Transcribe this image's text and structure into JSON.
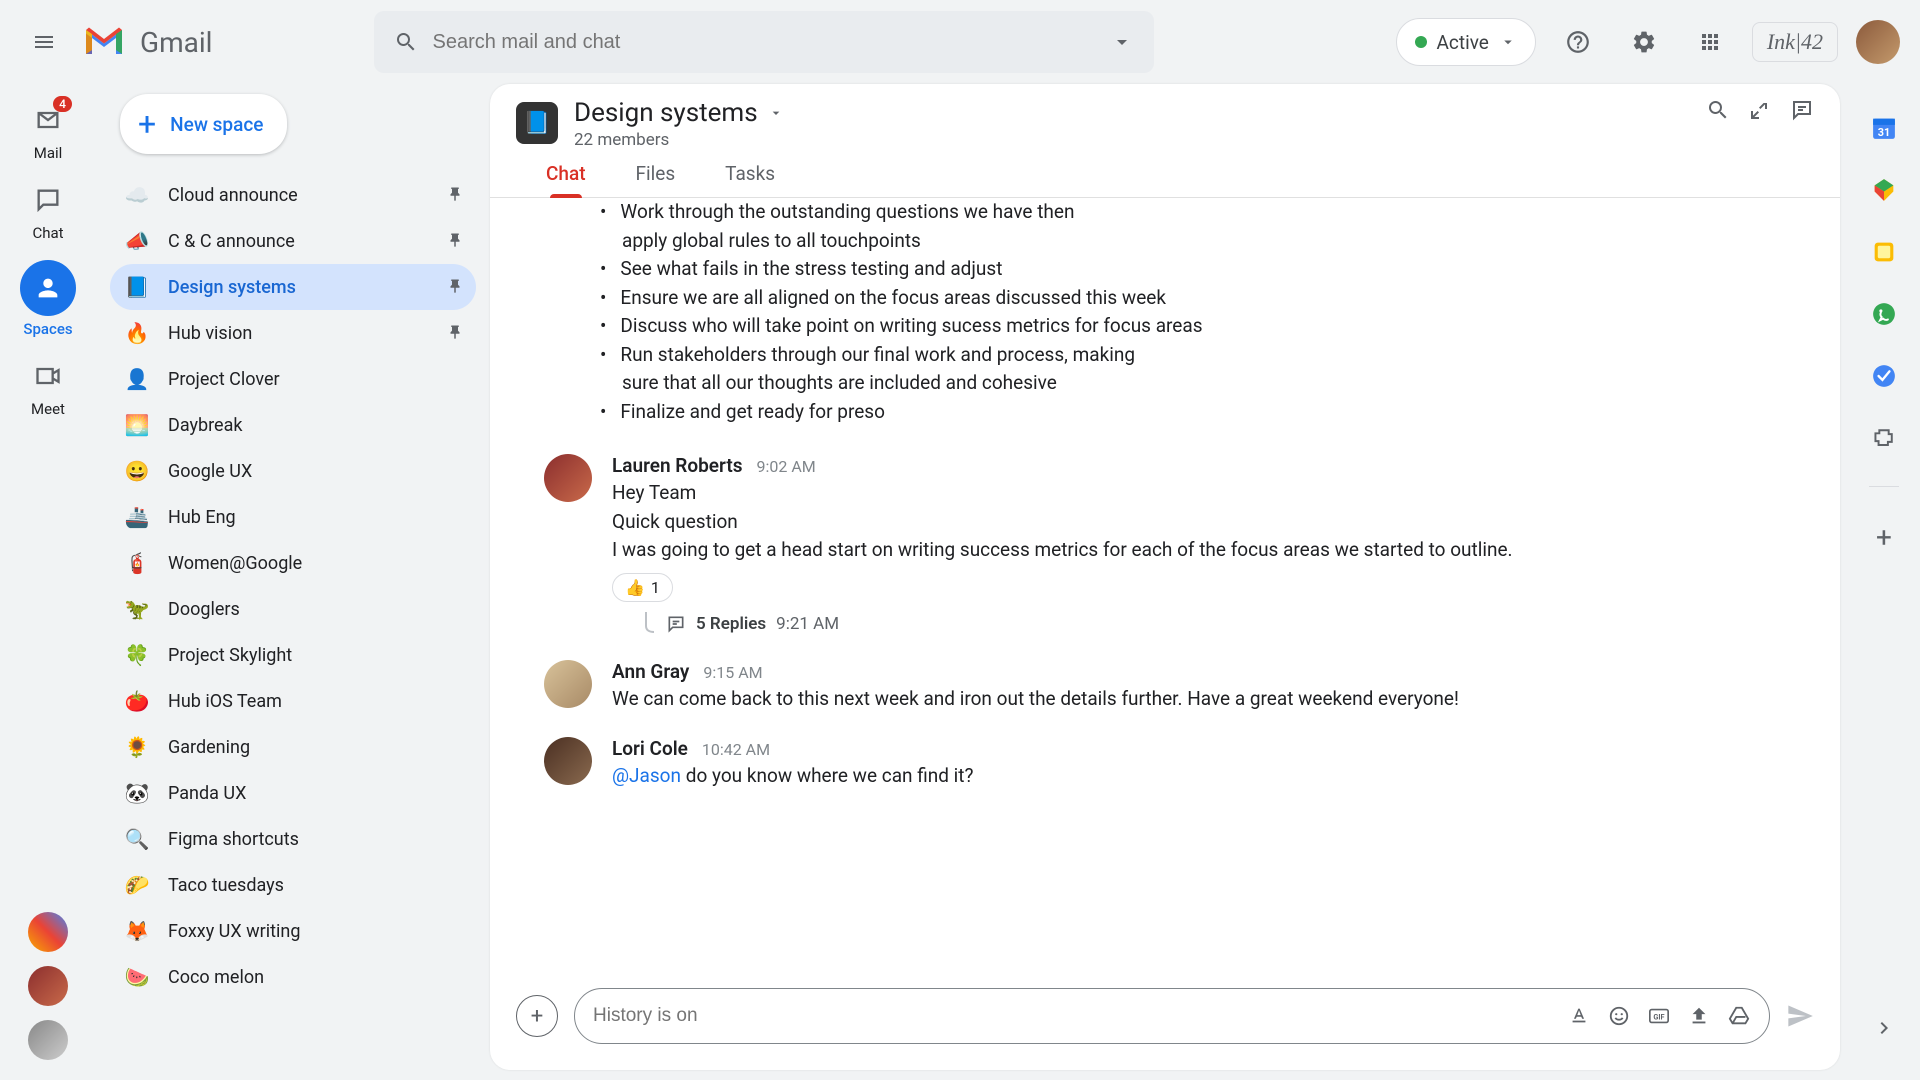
{
  "brand": {
    "name": "Gmail",
    "workspace_label": "Ink|42"
  },
  "search": {
    "placeholder": "Search mail and chat"
  },
  "status": {
    "label": "Active"
  },
  "rail": {
    "items": [
      {
        "label": "Mail",
        "badge": "4"
      },
      {
        "label": "Chat"
      },
      {
        "label": "Spaces",
        "active": true
      },
      {
        "label": "Meet"
      }
    ]
  },
  "sidebar": {
    "new_button": "New space",
    "items": [
      {
        "emoji": "☁️",
        "label": "Cloud announce",
        "pinned": true
      },
      {
        "emoji": "📣",
        "label": "C & C announce",
        "pinned": true
      },
      {
        "emoji": "📘",
        "label": "Design systems",
        "pinned": true,
        "active": true
      },
      {
        "emoji": "🔥",
        "label": "Hub vision",
        "pinned": true
      },
      {
        "emoji": "👤",
        "label": "Project Clover"
      },
      {
        "emoji": "🌅",
        "label": "Daybreak"
      },
      {
        "emoji": "😀",
        "label": "Google UX"
      },
      {
        "emoji": "🚢",
        "label": "Hub Eng"
      },
      {
        "emoji": "🧯",
        "label": "Women@Google"
      },
      {
        "emoji": "🦖",
        "label": "Dooglers"
      },
      {
        "emoji": "🍀",
        "label": "Project Skylight"
      },
      {
        "emoji": "🍅",
        "label": "Hub iOS Team"
      },
      {
        "emoji": "🌻",
        "label": "Gardening"
      },
      {
        "emoji": "🐼",
        "label": "Panda UX"
      },
      {
        "emoji": "🔍",
        "label": "Figma shortcuts"
      },
      {
        "emoji": "🌮",
        "label": "Taco tuesdays"
      },
      {
        "emoji": "🦊",
        "label": "Foxxy UX writing"
      },
      {
        "emoji": "🍉",
        "label": "Coco melon"
      }
    ]
  },
  "space": {
    "title": "Design systems",
    "subtitle": "22 members",
    "tabs": [
      {
        "label": "Chat",
        "active": true
      },
      {
        "label": "Files"
      },
      {
        "label": "Tasks"
      }
    ]
  },
  "bullets": [
    {
      "line": "Work through the outstanding questions we have then",
      "cont": "apply global rules to all touchpoints"
    },
    {
      "line": "See what fails in the stress testing and adjust"
    },
    {
      "line": "Ensure we are all aligned on the focus areas discussed this week"
    },
    {
      "line": "Discuss who will take point on writing sucess metrics for focus areas"
    },
    {
      "line": "Run stakeholders through our final work and process, making",
      "cont": "sure that all our thoughts are included and cohesive"
    },
    {
      "line": "Finalize and get ready for preso"
    }
  ],
  "messages": [
    {
      "author": "Lauren Roberts",
      "time": "9:02 AM",
      "lines": [
        "Hey Team",
        "Quick question",
        "I was going to get a head start on writing success metrics for each of the focus areas we started to outline."
      ],
      "reaction": {
        "emoji": "👍",
        "count": "1"
      },
      "thread": {
        "count": "5 Replies",
        "time": "9:21 AM"
      },
      "avatar_bg": "linear-gradient(135deg,#8b2e2e,#c96a4a)"
    },
    {
      "author": "Ann Gray",
      "time": "9:15 AM",
      "lines": [
        "We can come back to this next week and iron out the details further. Have a great weekend everyone!"
      ],
      "avatar_bg": "linear-gradient(135deg,#d8c29a,#a88a66)"
    },
    {
      "author": "Lori Cole",
      "time": "10:42 AM",
      "mention": "@Jason",
      "tail": " do you know where we can find it?",
      "avatar_bg": "linear-gradient(135deg,#4a2f22,#8a6a4f)"
    }
  ],
  "composer": {
    "placeholder": "History is on"
  }
}
